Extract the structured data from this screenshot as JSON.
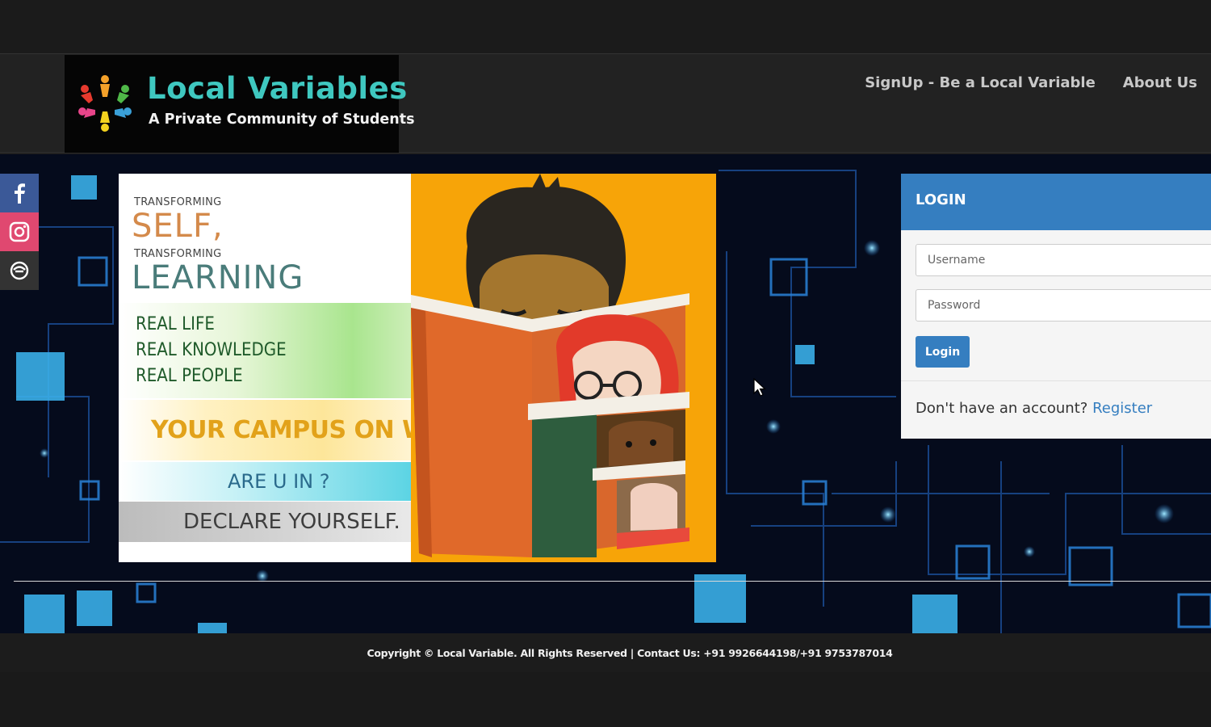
{
  "brand": {
    "title": "Local Variables",
    "tagline": "A Private Community of Students",
    "colors": {
      "teal": "#3fc8c0",
      "logo_bg": "#050505"
    }
  },
  "nav": {
    "signup": "SignUp - Be a Local Variable",
    "about": "About Us"
  },
  "social": {
    "items": [
      {
        "icon": "facebook-icon",
        "color": "#3b5998"
      },
      {
        "icon": "instagram-icon",
        "color": "#e04870"
      },
      {
        "icon": "other-social-icon",
        "color": "#333333"
      }
    ]
  },
  "banner": {
    "line1_small": "TRANSFORMING",
    "line1_big": "SELF,",
    "line2_small": "TRANSFORMING",
    "line2_big": "LEARNING",
    "points": [
      "REAL LIFE",
      "REAL KNOWLEDGE",
      "REAL PEOPLE"
    ],
    "campus": "YOUR CAMPUS ON WEB",
    "question": "ARE U IN ?",
    "declare": "DECLARE YOURSELF.",
    "illustration_bg": "#f7a408"
  },
  "login": {
    "title": "LOGIN",
    "username_placeholder": "Username",
    "password_placeholder": "Password",
    "button": "Login",
    "no_account": "Don't have an account?",
    "register": "Register",
    "accent": "#357ec0"
  },
  "footer": {
    "text": "Copyright © Local Variable. All Rights Reserved | Contact Us: +91 9926644198/+91 9753787014"
  }
}
